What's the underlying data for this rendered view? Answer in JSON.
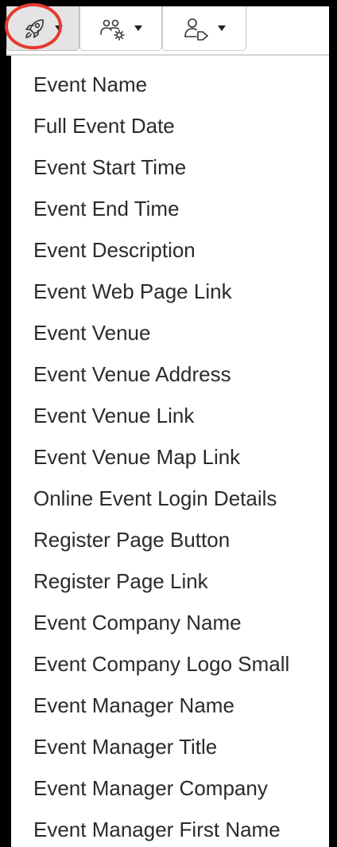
{
  "toolbar": {
    "buttons": [
      {
        "name": "event",
        "icon": "rocket-icon",
        "selected": true
      },
      {
        "name": "attendees",
        "icon": "people-settings-icon",
        "selected": false
      },
      {
        "name": "contact",
        "icon": "person-tag-icon",
        "selected": false
      }
    ],
    "highlight_color": "#e63a2e"
  },
  "menu": {
    "items": [
      "Event Name",
      "Full Event Date",
      "Event Start Time",
      "Event End Time",
      "Event Description",
      "Event Web Page Link",
      "Event Venue",
      "Event Venue Address",
      "Event Venue Link",
      "Event Venue Map Link",
      "Online Event Login Details",
      "Register Page Button",
      "Register Page Link",
      "Event Company Name",
      "Event Company Logo Small",
      "Event Manager Name",
      "Event Manager Title",
      "Event Manager Company",
      "Event Manager First Name"
    ]
  }
}
